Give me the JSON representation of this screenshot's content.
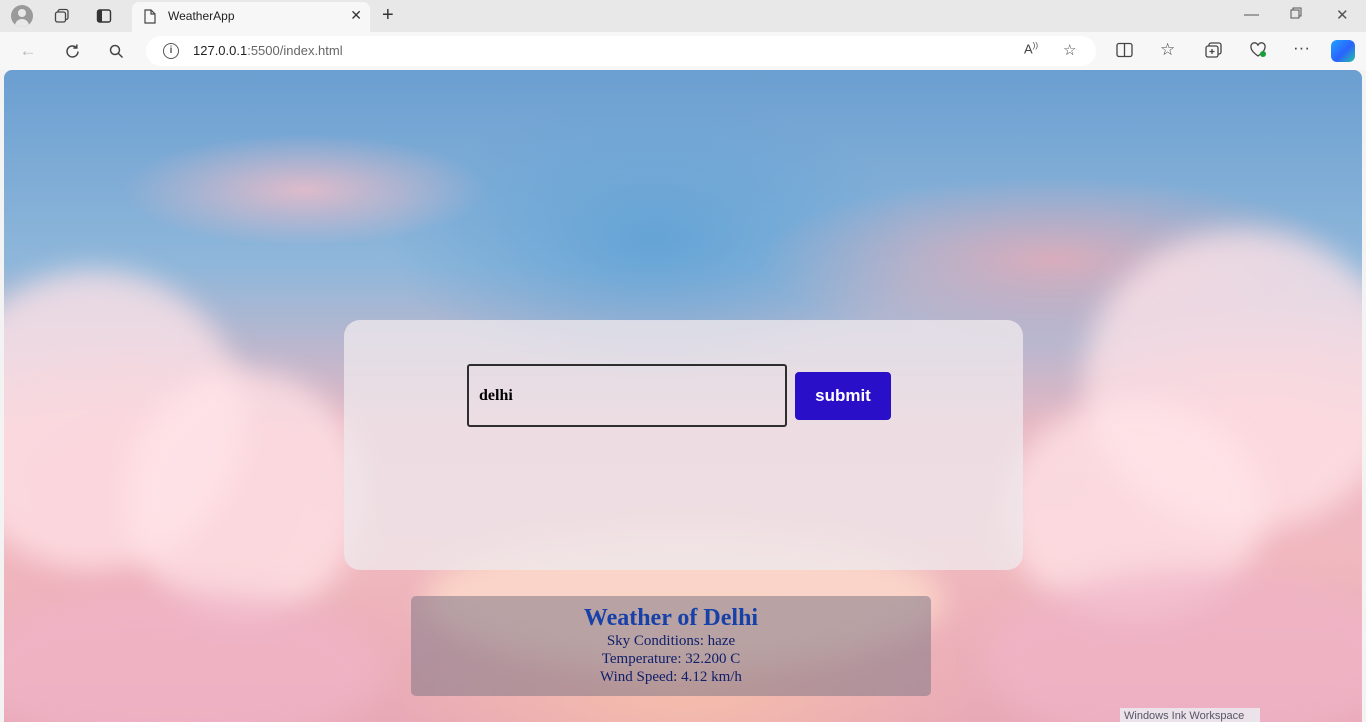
{
  "browser": {
    "tab_title": "WeatherApp",
    "url_host": "127.0.0.1",
    "url_rest": ":5500/index.html",
    "icons": [
      "profile-icon",
      "workspaces-icon",
      "tab-actions-icon",
      "page-icon",
      "close-icon",
      "new-tab-icon",
      "back-icon",
      "refresh-icon",
      "search-icon",
      "info-icon",
      "read-aloud-icon",
      "favorite-icon",
      "split-screen-icon",
      "favorites-icon",
      "collections-icon",
      "browser-essentials-icon",
      "more-icon",
      "copilot-icon",
      "minimize-icon",
      "restore-icon",
      "close-window-icon"
    ]
  },
  "search": {
    "value": "delhi",
    "submit_label": "submit"
  },
  "result": {
    "title": "Weather of Delhi",
    "sky": "Sky Conditions: haze",
    "temperature": "Temperature: 32.200 C",
    "wind": "Wind Speed: 4.12 km/h"
  },
  "overlay": {
    "ink_workspace": "Windows Ink Workspace"
  },
  "colors": {
    "submit_bg": "#2a0fc9",
    "title_color": "#1741a8"
  }
}
